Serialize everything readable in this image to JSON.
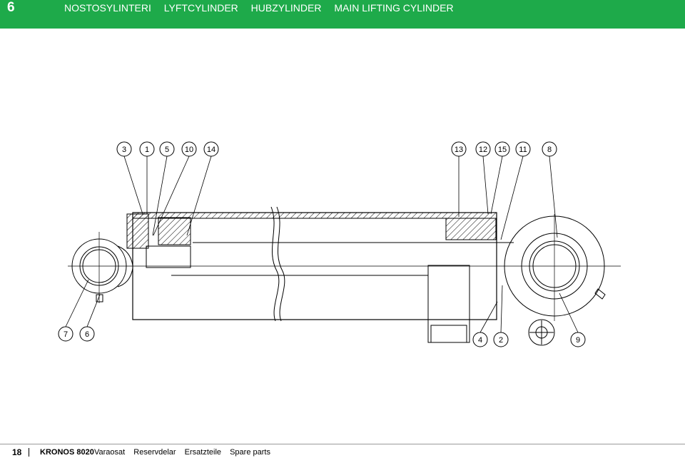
{
  "header": {
    "page_number": "6",
    "titles": [
      "NOSTOSYLINTERI",
      "LYFTCYLINDER",
      "HUBZYLINDER",
      "MAIN LIFTING CYLINDER"
    ]
  },
  "drawing": {
    "callouts_top_left": [
      "3",
      "1",
      "5",
      "10",
      "14"
    ],
    "callouts_top_right": [
      "13",
      "12",
      "15",
      "11",
      "8"
    ],
    "callouts_bottom_left": [
      "7",
      "6"
    ],
    "callouts_bottom_right": [
      "4",
      "2",
      "9"
    ]
  },
  "footer": {
    "page_number": "18",
    "product": "KRONOS 8020",
    "parts_labels": [
      "Varaosat",
      "Reservdelar",
      "Ersatzteile",
      "Spare parts"
    ]
  },
  "colors": {
    "header_green": "#1eaa4a",
    "hatch": "#000000"
  }
}
